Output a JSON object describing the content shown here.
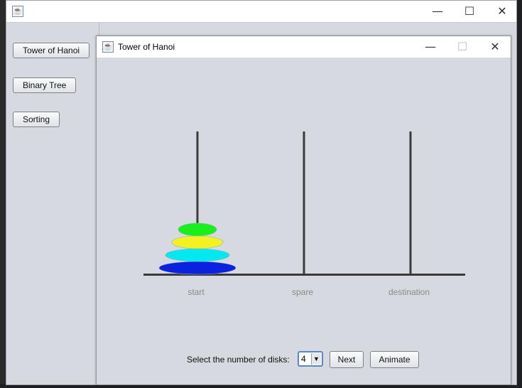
{
  "main_window": {
    "title": "",
    "controls": {
      "minimize": "—",
      "maximize": "☐",
      "close": "✕"
    },
    "sidebar_buttons": [
      "Tower of Hanoi",
      "Binary Tree",
      "Sorting"
    ]
  },
  "hanoi_window": {
    "title": "Tower of Hanoi",
    "controls": {
      "minimize": "—",
      "maximize": "☐",
      "close": "✕"
    },
    "pegs": [
      "start",
      "spare",
      "destination"
    ],
    "disks": [
      {
        "peg": "start",
        "size": 4,
        "color": "#0a22e0"
      },
      {
        "peg": "start",
        "size": 3,
        "color": "#00e8f0"
      },
      {
        "peg": "start",
        "size": 2,
        "color": "#f2f221"
      },
      {
        "peg": "start",
        "size": 1,
        "color": "#19f01a"
      }
    ],
    "select_label": "Select the number of disks:",
    "selected_disks": "4",
    "next_label": "Next",
    "animate_label": "Animate"
  },
  "colors": {
    "window_bg": "#d6d9df",
    "rod": "#3a3a3a",
    "peg_label": "#8a8a8a"
  }
}
